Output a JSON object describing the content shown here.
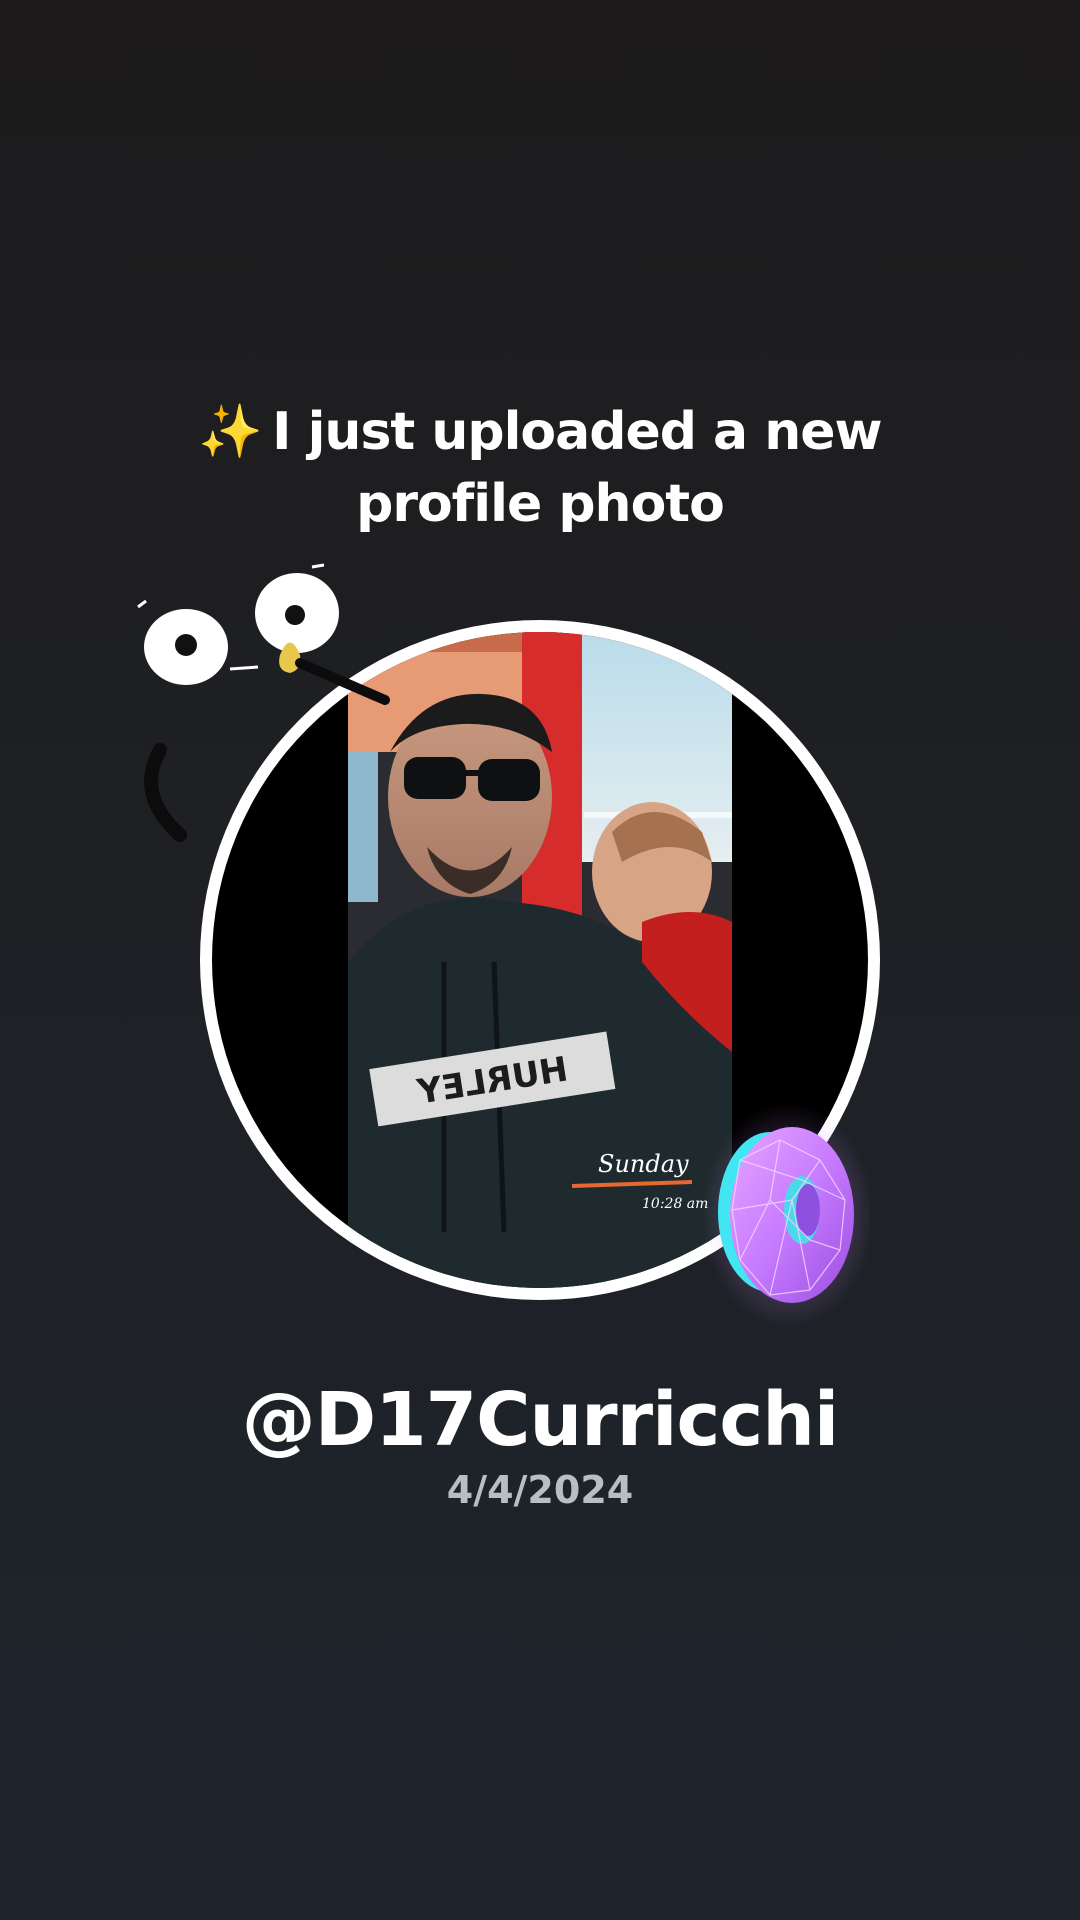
{
  "headline": {
    "sparkle": "✨",
    "line1": "I just uploaded a new",
    "line2": "profile photo"
  },
  "profile": {
    "username": "@D17Curricchi",
    "date": "4/4/2024"
  },
  "photo": {
    "shirt_brand": "HURLEY",
    "overlay_day": "Sunday",
    "overlay_time": "10:28 am"
  },
  "stickers": {
    "eyes": "googly-eyes-sticker",
    "donut": "holographic-donut-sticker"
  },
  "colors": {
    "background_top": "#1d1b1c",
    "background_bottom": "#1e252d",
    "ring": "#ffffff",
    "donut": "#c77bff"
  }
}
